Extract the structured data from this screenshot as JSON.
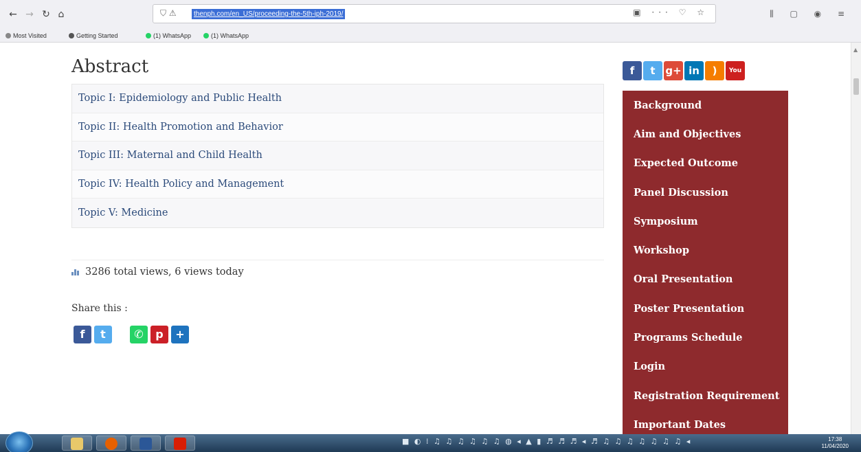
{
  "browser": {
    "url": "thenph.com/en_US/proceeding-the-5th-iph-2019/",
    "bookmarks": [
      "Most Visited",
      "Getting Started",
      "(1) WhatsApp",
      "(1) WhatsApp"
    ]
  },
  "main": {
    "title": "Abstract",
    "topics": [
      "Topic I: Epidemiology and Public Health",
      "Topic II: Health Promotion and Behavior",
      "Topic III: Maternal and Child Health",
      "Topic IV: Health Policy and Management",
      "Topic V: Medicine"
    ],
    "views": "3286 total views, 6 views today",
    "share_label": "Share this :",
    "share_buttons": [
      "facebook-icon",
      "twitter-icon",
      "whatsapp-icon",
      "pinterest-icon",
      "more-share-icon"
    ]
  },
  "sidebar": {
    "social": [
      "facebook-icon",
      "twitter-icon",
      "google-plus-icon",
      "linkedin-icon",
      "rss-icon",
      "youtube-icon"
    ],
    "menu": [
      "Background",
      "Aim and Objectives",
      "Expected Outcome",
      "Panel Discussion",
      "Symposium",
      "Workshop",
      "Oral Presentation",
      "Poster Presentation",
      "Programs Schedule",
      "Login",
      "Registration Requirement",
      "Important Dates"
    ]
  },
  "taskbar": {
    "time": "17:38",
    "date": "11/04/2020"
  },
  "colors": {
    "menu_bg": "#8e2a2d",
    "link": "#2b4a7a",
    "facebook": "#3b5998",
    "twitter": "#55acee",
    "whatsapp": "#25d366",
    "pinterest": "#cb2027",
    "more": "#1e73be"
  }
}
